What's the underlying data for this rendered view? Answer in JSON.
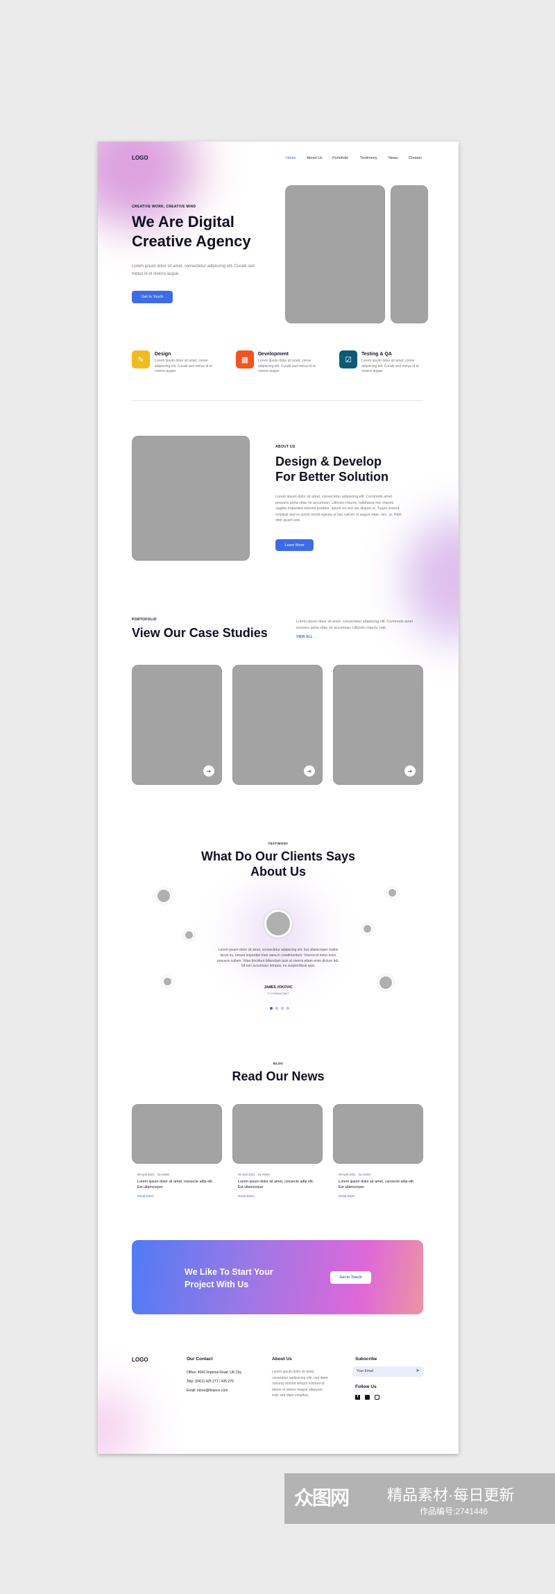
{
  "header": {
    "logo": "LOGO",
    "nav": [
      "Home",
      "About Us",
      "Portofolio",
      "Testimony",
      "News",
      "Contact"
    ],
    "active": "Home"
  },
  "hero": {
    "tagline": "CREATIVE WORK, CREATIVE MIND",
    "title_line1": "We Are Digital",
    "title_line2": "Creative Agency",
    "text": "Lorem ipsum dolor sit amet, consectetur adipiscing elit. Curabi sed metus id et viverra augue.",
    "button": "Get In Touch"
  },
  "features": [
    {
      "title": "Design",
      "text": "Lorem ipsum dolor sit amet, conse adipiscing elit. Curabi sed metus id et viverra augue.",
      "icon": "pen-tool-icon",
      "color": "#f0bb1e"
    },
    {
      "title": "Development",
      "text": "Lorem ipsum dolor sit amet, conse adipiscing elit. Curabi sed metus id et viverra augue.",
      "icon": "grid-icon",
      "color": "#f1541f"
    },
    {
      "title": "Testing & QA",
      "text": "Lorem ipsum dolor sit amet, conse adipiscing elit. Curabi sed metus id et viverra augue.",
      "icon": "checkbox-icon",
      "color": "#0c5a78"
    }
  ],
  "about": {
    "label": "ABOUT US",
    "title_line1": "Design & Develop",
    "title_line2": "For Better Solution",
    "text": "Lorem ipsum dolor sit amet, consectetur adipiscing elit. Commodo amet posuere porta vitae mi accumsan. Ultricies mauris, habitasse nec mauris sagittis imperdiet lobortis porttitor. Ipsum mi sed uta aliquet ut. Turpis viverra volutpat sed eu porta morbi egesta ut hac rutrum ut augue vitae, nec, ut. Nibh nibh quam sed.",
    "button": "Learn More"
  },
  "portfolio": {
    "label": "PORTOFOLIO",
    "title": "View Our Case Studies",
    "text": "Lorem ipsum dolor sit amet, consectetur adipiscing elit. Commodo amet posuere porta vitae mi accumsan. Ultricies mauris, hab",
    "view_all": "VIEW ALL"
  },
  "testimony": {
    "label": "TESTIMONY",
    "title_line1": "What Do Our Clients Says",
    "title_line2": "About Us",
    "quote": "Lorem ipsum dolor sit amet, consectetur adipiscing elit. Est ullamcorper mattis lacus eu, ornare imperdiet men sana in condimentum. Viverra id tortor enim posuere nullam. Vitae tincidunt bibendum quis at viverra etiam enim dictum teb. Sit non accumsan tempus, eu suspendisse quis.",
    "name": "JAMES JOKOVIC",
    "role": "IT CONSULTANT",
    "active_dot": 1,
    "dot_count": 4
  },
  "blog": {
    "label": "BLOG",
    "title": "Read Our News",
    "posts": [
      {
        "date": "09 April 2021",
        "author": "by Admin",
        "title": "Lorem ipsum dolor sit amet, consecte adip elit. Est ullamcorper",
        "link": "Read More"
      },
      {
        "date": "09 April 2021",
        "author": "by Admin",
        "title": "Lorem ipsum dolor sit amet, consecte adip elit. Est ullamcorper",
        "link": "Read More"
      },
      {
        "date": "09 April 2021",
        "author": "by Admin",
        "title": "Lorem ipsum dolor sit amet, consecte adip elit. Est ullamcorper",
        "link": "Read More"
      }
    ]
  },
  "cta": {
    "title_line1": "We Like To Start Your",
    "title_line2": "Project With Us",
    "button": "Get In Touch"
  },
  "footer": {
    "logo": "LOGO",
    "contact_title": "Our Contact",
    "office": "Office: 4042 Imperial Road, UK City",
    "phone": "Telp: (0411) 425 277 / 425 276",
    "email": "Email: inbox@finance.com",
    "about_title": "About Us",
    "about_text": "Lorem ipsum dolor sit amet, consetetur sadipscing elitr, sed diam nonumy eirmod tempor invidunt ut labore et dolore magna aliquyam erat, sed diam voluptua",
    "subscribe_title": "Subscribe",
    "email_placeholder": "Your Email",
    "follow_title": "Follow Us"
  },
  "watermark": {
    "brand": "众图网",
    "slogan": "精品素材·每日更新",
    "id": "作品编号:2741446"
  },
  "colors": {
    "accent": "#3e6be6",
    "cta_start": "#4f7bf5",
    "cta_mid": "#de68d8",
    "cta_end": "#ec94a2"
  }
}
